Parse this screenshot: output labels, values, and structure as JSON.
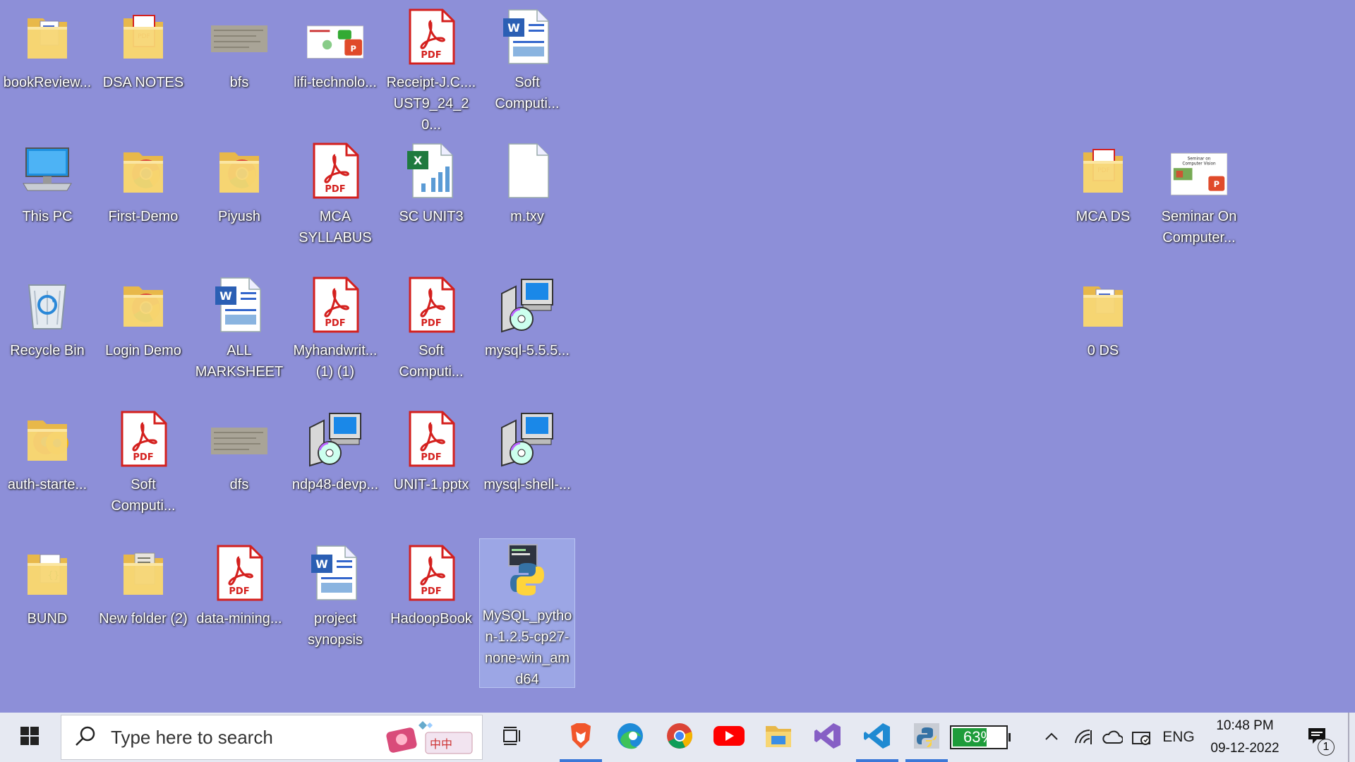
{
  "desktop": {
    "icons": [
      {
        "label": "bookReview...",
        "type": "folder-file"
      },
      {
        "label": "DSA NOTES",
        "type": "folder-pdf"
      },
      {
        "label": "bfs",
        "type": "image"
      },
      {
        "label": "lifi-technolo...",
        "type": "pptx-thumb"
      },
      {
        "label": "Receipt-J.C....\nUST9_24_20...",
        "type": "pdf"
      },
      {
        "label": "Soft\nComputi...",
        "type": "word"
      },
      {
        "label": "This PC",
        "type": "computer"
      },
      {
        "label": "First-Demo",
        "type": "folder-chrome"
      },
      {
        "label": "Piyush",
        "type": "folder-chrome"
      },
      {
        "label": "MCA\nSYLLABUS",
        "type": "pdf"
      },
      {
        "label": "SC UNIT3",
        "type": "excel"
      },
      {
        "label": "m.txy",
        "type": "blank-file"
      },
      {
        "label": "Recycle Bin",
        "type": "recycle-bin"
      },
      {
        "label": "Login Demo",
        "type": "folder-chrome"
      },
      {
        "label": "ALL\nMARKSHEET",
        "type": "word"
      },
      {
        "label": "Myhandwrit...\n(1) (1)",
        "type": "pdf"
      },
      {
        "label": "Soft\nComputi...",
        "type": "pdf"
      },
      {
        "label": "mysql-5.5.5...",
        "type": "installer"
      },
      {
        "label": "auth-starte...",
        "type": "folder-chrome2"
      },
      {
        "label": "Soft\nComputi...",
        "type": "pdf"
      },
      {
        "label": "dfs",
        "type": "image"
      },
      {
        "label": "ndp48-devp...",
        "type": "installer"
      },
      {
        "label": "UNIT-1.pptx",
        "type": "pdf"
      },
      {
        "label": "mysql-shell-...",
        "type": "installer"
      },
      {
        "label": "BUND",
        "type": "folder-vscode"
      },
      {
        "label": "New folder (2)",
        "type": "folder-doc"
      },
      {
        "label": "data-mining...",
        "type": "pdf"
      },
      {
        "label": "project\nsynopsis",
        "type": "word"
      },
      {
        "label": "HadoopBook",
        "type": "pdf"
      },
      {
        "label": "MySQL_pytho\nn-1.2.5-cp27-\nnone-win_am\nd64",
        "type": "python",
        "selected": true
      },
      {
        "label": "MCA DS",
        "type": "folder-pdf"
      },
      {
        "label": "Seminar On\nComputer...",
        "type": "seminar-thumb"
      },
      {
        "label": "0 DS",
        "type": "folder-file"
      }
    ],
    "pdf_badge": "PDF",
    "seminar_thumb_text": "Seminar on\nComputer Vision"
  },
  "taskbar": {
    "start_icon": "windows-logo-icon",
    "search_placeholder": "Type here to search",
    "apps": [
      {
        "name": "task-view-icon"
      },
      {
        "name": "brave-icon"
      },
      {
        "name": "edge-icon"
      },
      {
        "name": "chrome-icon"
      },
      {
        "name": "youtube-icon"
      },
      {
        "name": "file-explorer-icon"
      },
      {
        "name": "visual-studio-icon"
      },
      {
        "name": "vscode-icon"
      },
      {
        "name": "python-app-icon"
      }
    ],
    "battery_percent": "63%",
    "battery_level": 0.63,
    "language": "ENG",
    "time": "10:48 PM",
    "date": "09-12-2022",
    "notification_count": "1"
  },
  "colors": {
    "desktop_bg": "#8d8fd8",
    "taskbar_bg": "#e6e9f2",
    "accent": "#3b78d8"
  }
}
